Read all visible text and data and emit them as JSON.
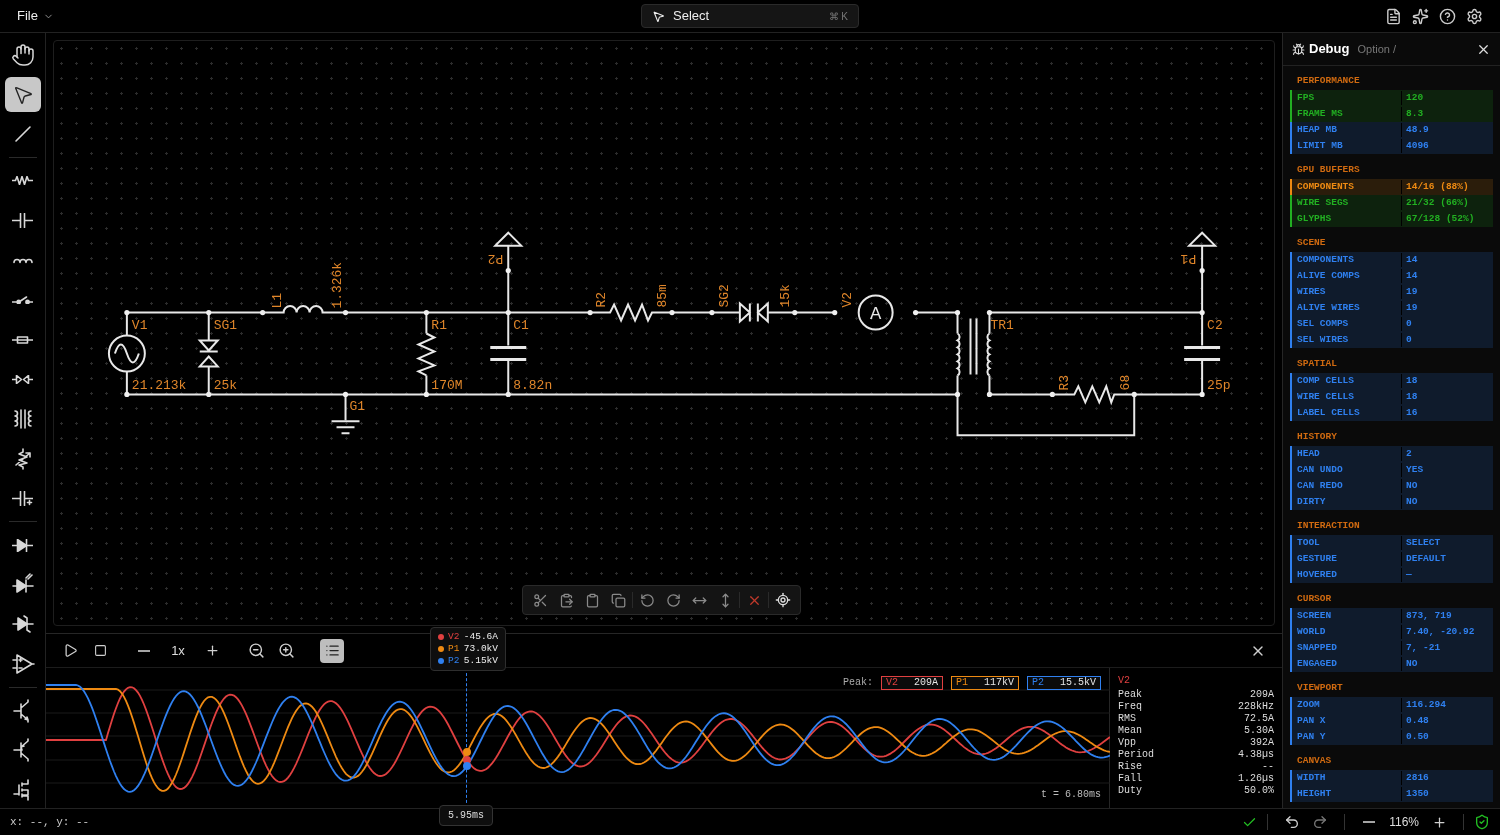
{
  "menu": {
    "label": "File"
  },
  "command": {
    "label": "Select",
    "shortcut": "⌘ K"
  },
  "tool_groups": [
    [
      {
        "kind": "hand",
        "selected": false
      },
      {
        "kind": "pointer",
        "selected": true
      },
      {
        "kind": "wire",
        "selected": false
      }
    ],
    [
      {
        "kind": "resistor",
        "selected": false
      },
      {
        "kind": "capacitor",
        "selected": false
      },
      {
        "kind": "inductor",
        "selected": false
      },
      {
        "kind": "switch",
        "selected": false
      },
      {
        "kind": "fuse",
        "selected": false
      },
      {
        "kind": "spark_gap",
        "selected": false
      },
      {
        "kind": "transformer",
        "selected": false
      },
      {
        "kind": "potentiometer",
        "selected": false
      },
      {
        "kind": "polarized_capacitor",
        "selected": false
      }
    ],
    [
      {
        "kind": "diode",
        "selected": false
      },
      {
        "kind": "led",
        "selected": false
      },
      {
        "kind": "zener",
        "selected": false
      },
      {
        "kind": "opamp",
        "selected": false
      }
    ],
    [
      {
        "kind": "npn",
        "selected": false
      },
      {
        "kind": "pnp",
        "selected": false
      },
      {
        "kind": "mosfet",
        "selected": false
      }
    ]
  ],
  "schematic": {
    "parts": [
      {
        "name": "V1",
        "value": "21.213k"
      },
      {
        "name": "SG1",
        "value": "25k"
      },
      {
        "name": "L1",
        "value": "1.326k"
      },
      {
        "name": "R1",
        "value": "170M"
      },
      {
        "name": "C1",
        "value": "8.82n"
      },
      {
        "name": "P2"
      },
      {
        "name": "R2",
        "value": "85m"
      },
      {
        "name": "SG2",
        "value": "15k"
      },
      {
        "name": "V2",
        "symbol": "A"
      },
      {
        "name": "TR1"
      },
      {
        "name": "R3",
        "value": "68"
      },
      {
        "name": "C2",
        "value": "25p"
      },
      {
        "name": "P1"
      },
      {
        "name": "G1"
      }
    ]
  },
  "scope": {
    "speed": "1x",
    "list_on": true,
    "peak_label": "Peak:",
    "channels": [
      {
        "name": "V2",
        "peak": "209A",
        "color": "#e04040"
      },
      {
        "name": "P1",
        "peak": "117kV",
        "color": "#ee8a12"
      },
      {
        "name": "P2",
        "peak": "15.5kV",
        "color": "#2f80f0"
      }
    ],
    "cursor": {
      "time": "5.95ms",
      "readings": [
        {
          "name": "V2",
          "value": "-45.6A",
          "color": "#e04040"
        },
        {
          "name": "P1",
          "value": "73.0kV",
          "color": "#ee8a12"
        },
        {
          "name": "P2",
          "value": "5.15kV",
          "color": "#2f80f0"
        }
      ]
    },
    "time": "t = 6.80ms",
    "stats": {
      "title": "V2",
      "rows": [
        {
          "label": "Peak",
          "value": "209A"
        },
        {
          "label": "Freq",
          "value": "228kHz"
        },
        {
          "label": "RMS",
          "value": "72.5A"
        },
        {
          "label": "Mean",
          "value": "5.30A"
        },
        {
          "label": "Vpp",
          "value": "392A"
        },
        {
          "label": "Period",
          "value": "4.38µs"
        },
        {
          "label": "Rise",
          "value": "--"
        },
        {
          "label": "Fall",
          "value": "1.26µs"
        },
        {
          "label": "Duty",
          "value": "50.0%"
        }
      ]
    }
  },
  "debug": {
    "title": "Debug",
    "hint": "Option /",
    "sections": [
      {
        "title": "PERFORMANCE",
        "rows": [
          {
            "label": "FPS",
            "value": "120",
            "color": "#22b022"
          },
          {
            "label": "FRAME MS",
            "value": "8.3",
            "color": "#22b022"
          },
          {
            "label": "HEAP MB",
            "value": "48.9",
            "color": "#2f80f0"
          },
          {
            "label": "LIMIT MB",
            "value": "4096",
            "color": "#2f80f0"
          }
        ]
      },
      {
        "title": "GPU BUFFERS",
        "rows": [
          {
            "label": "COMPONENTS",
            "value": "14/16 (88%)",
            "color": "#ee8a12"
          },
          {
            "label": "WIRE SEGS",
            "value": "21/32 (66%)",
            "color": "#22b022"
          },
          {
            "label": "GLYPHS",
            "value": "67/128 (52%)",
            "color": "#22b022"
          }
        ]
      },
      {
        "title": "SCENE",
        "rows": [
          {
            "label": "COMPONENTS",
            "value": "14",
            "color": "#2f80f0"
          },
          {
            "label": "ALIVE COMPS",
            "value": "14",
            "color": "#2f80f0"
          },
          {
            "label": "WIRES",
            "value": "19",
            "color": "#2f80f0"
          },
          {
            "label": "ALIVE WIRES",
            "value": "19",
            "color": "#2f80f0"
          },
          {
            "label": "SEL COMPS",
            "value": "0",
            "color": "#2f80f0"
          },
          {
            "label": "SEL WIRES",
            "value": "0",
            "color": "#2f80f0"
          }
        ]
      },
      {
        "title": "SPATIAL",
        "rows": [
          {
            "label": "COMP CELLS",
            "value": "18",
            "color": "#2f80f0"
          },
          {
            "label": "WIRE CELLS",
            "value": "18",
            "color": "#2f80f0"
          },
          {
            "label": "LABEL CELLS",
            "value": "16",
            "color": "#2f80f0"
          }
        ]
      },
      {
        "title": "HISTORY",
        "rows": [
          {
            "label": "HEAD",
            "value": "2",
            "color": "#2f80f0"
          },
          {
            "label": "CAN UNDO",
            "value": "YES",
            "color": "#2f80f0"
          },
          {
            "label": "CAN REDO",
            "value": "NO",
            "color": "#2f80f0"
          },
          {
            "label": "DIRTY",
            "value": "NO",
            "color": "#2f80f0"
          }
        ]
      },
      {
        "title": "INTERACTION",
        "rows": [
          {
            "label": "TOOL",
            "value": "SELECT",
            "color": "#2f80f0"
          },
          {
            "label": "GESTURE",
            "value": "DEFAULT",
            "color": "#2f80f0"
          },
          {
            "label": "HOVERED",
            "value": "—",
            "color": "#2f80f0"
          }
        ]
      },
      {
        "title": "CURSOR",
        "rows": [
          {
            "label": "SCREEN",
            "value": "873, 719",
            "color": "#2f80f0"
          },
          {
            "label": "WORLD",
            "value": "7.40, -20.92",
            "color": "#2f80f0"
          },
          {
            "label": "SNAPPED",
            "value": "7, -21",
            "color": "#2f80f0"
          },
          {
            "label": "ENGAGED",
            "value": "NO",
            "color": "#2f80f0"
          }
        ]
      },
      {
        "title": "VIEWPORT",
        "rows": [
          {
            "label": "ZOOM",
            "value": "116.294",
            "color": "#2f80f0"
          },
          {
            "label": "PAN X",
            "value": "0.48",
            "color": "#2f80f0"
          },
          {
            "label": "PAN Y",
            "value": "0.50",
            "color": "#2f80f0"
          }
        ]
      },
      {
        "title": "CANVAS",
        "rows": [
          {
            "label": "WIDTH",
            "value": "2816",
            "color": "#2f80f0"
          },
          {
            "label": "HEIGHT",
            "value": "1350",
            "color": "#2f80f0"
          }
        ]
      }
    ]
  },
  "status": {
    "coords": "x: --, y: --",
    "zoom": "116%"
  }
}
